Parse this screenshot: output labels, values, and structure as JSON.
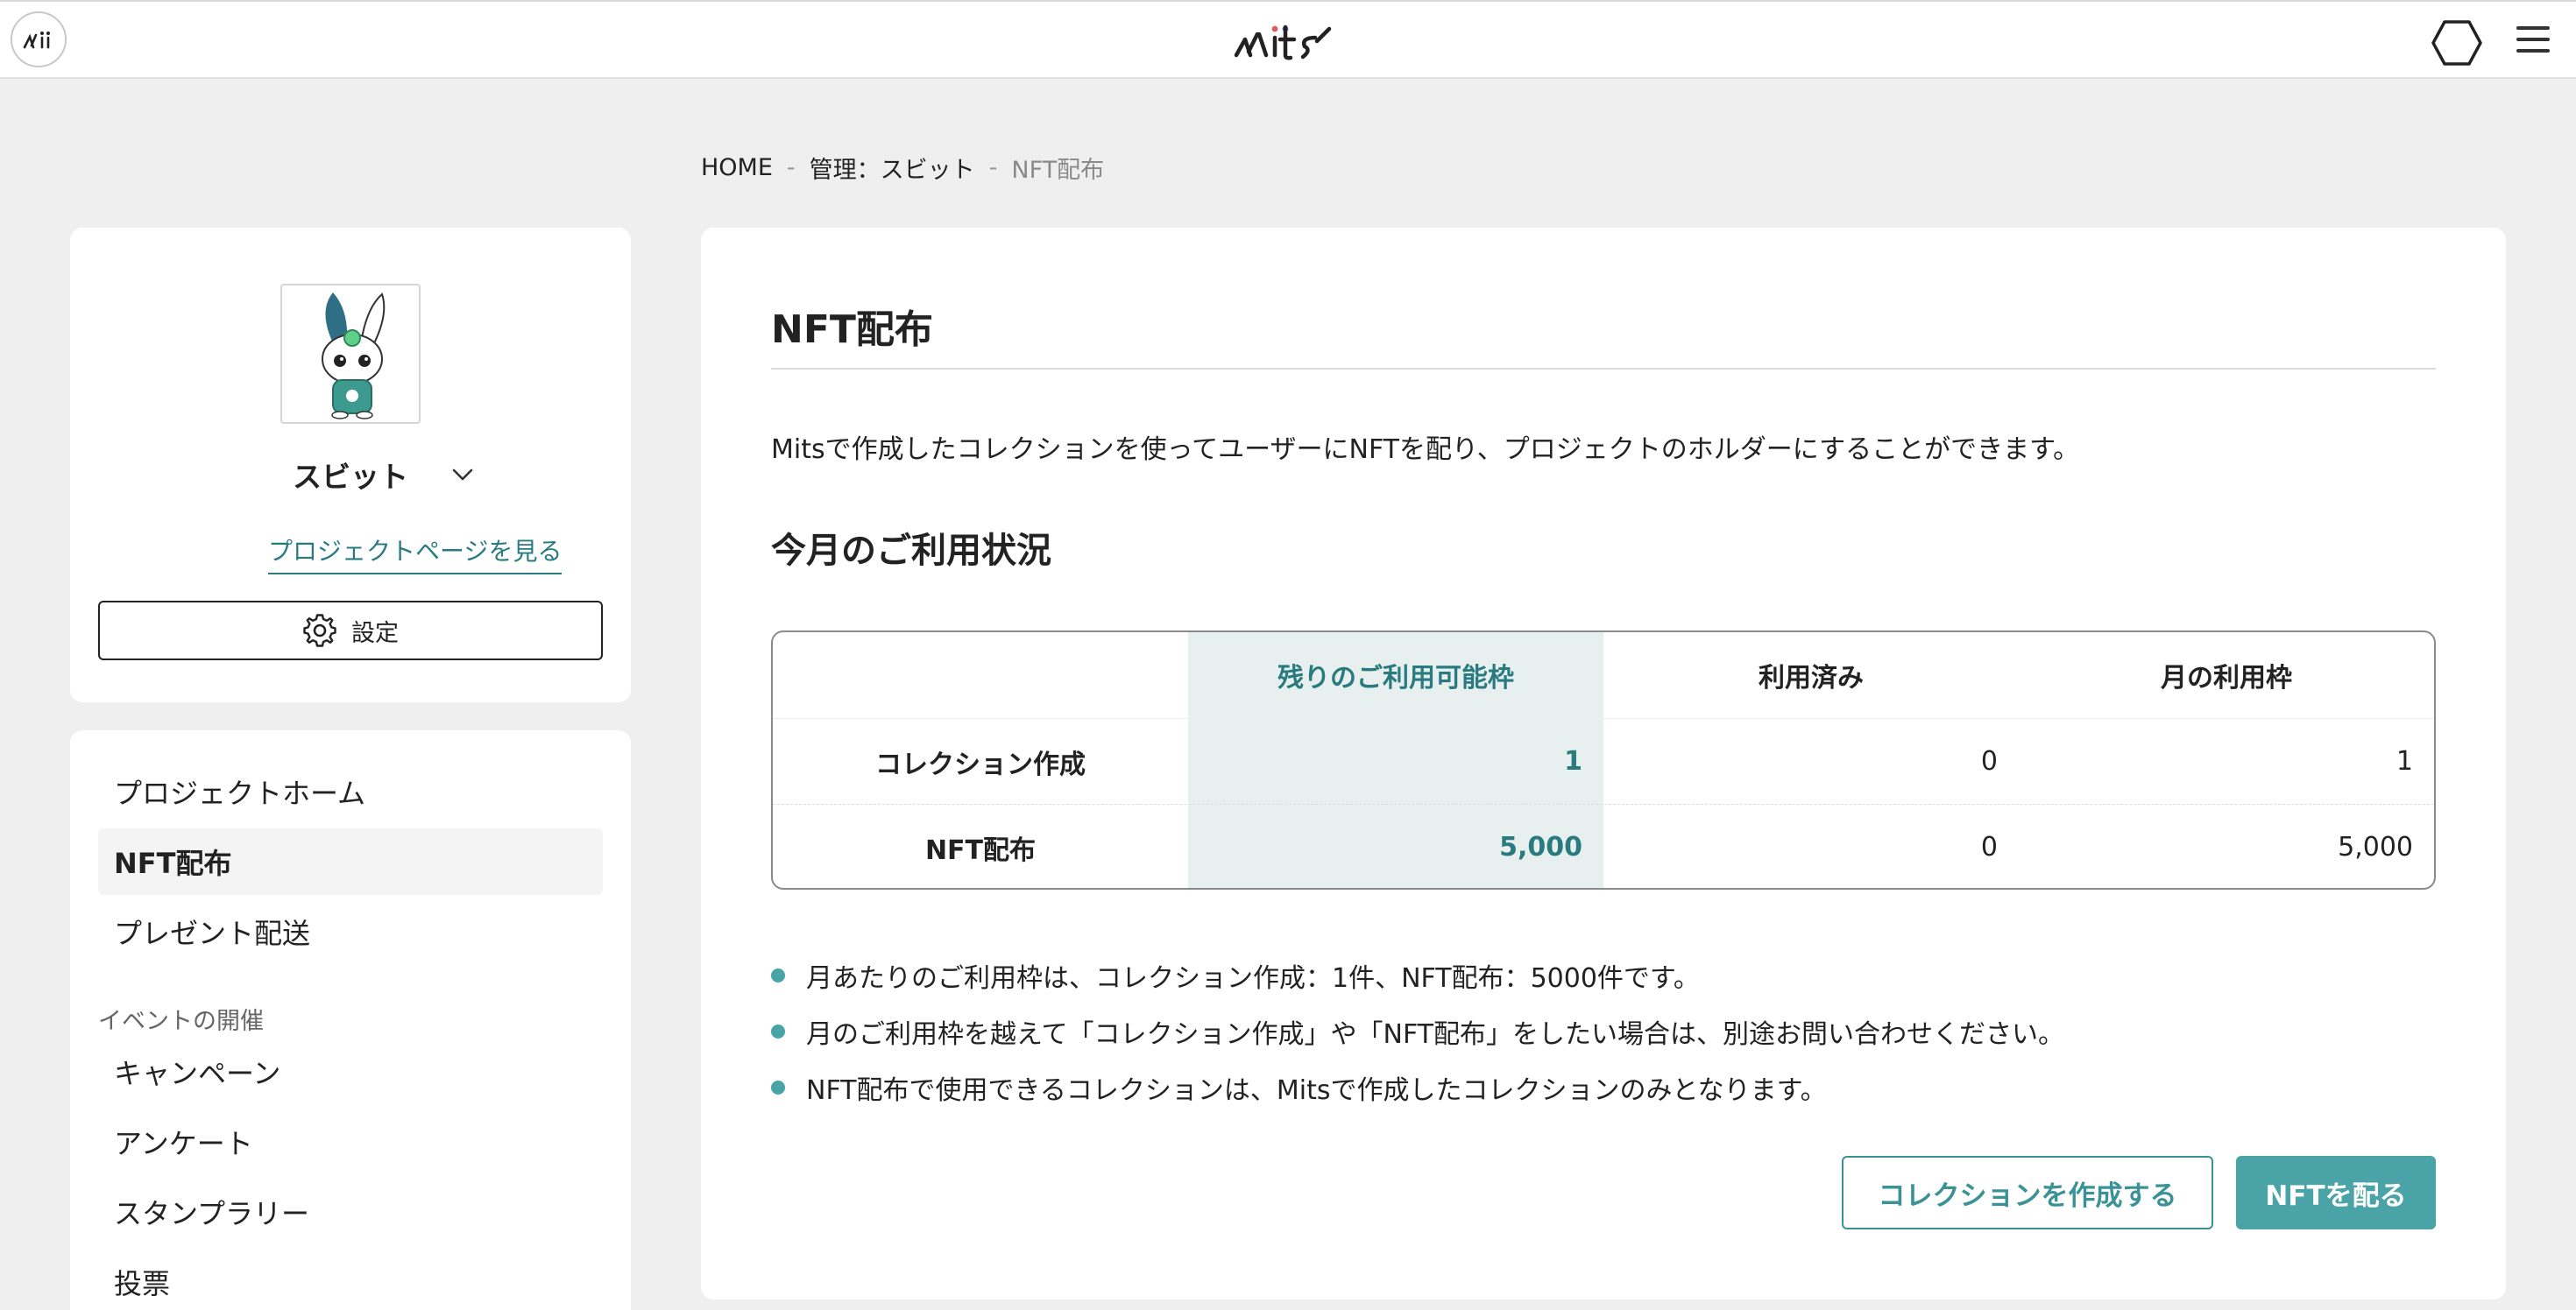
{
  "header": {
    "avatar_icon": "user-avatar-icon",
    "logo_text": "mits",
    "right_icons": [
      "hexagon-icon",
      "menu-icon"
    ]
  },
  "breadcrumb": {
    "items": [
      "HOME",
      "管理：スビット",
      "NFT配布"
    ],
    "separator": "-"
  },
  "sidebar": {
    "project_name": "スビット",
    "project_page_link": "プロジェクトページを見る",
    "settings_label": "設定",
    "nav": {
      "items": [
        {
          "label": "プロジェクトホーム",
          "active": false
        },
        {
          "label": "NFT配布",
          "active": true
        },
        {
          "label": "プレゼント配送",
          "active": false
        }
      ],
      "section_label": "イベントの開催",
      "section_items": [
        "キャンペーン",
        "アンケート",
        "スタンプラリー",
        "投票"
      ]
    }
  },
  "main": {
    "title": "NFT配布",
    "description": "Mitsで作成したコレクションを使ってユーザーにNFTを配り、プロジェクトのホルダーにすることができます。",
    "usage_heading": "今月のご利用状況",
    "table": {
      "headers": [
        "",
        "残りのご利用可能枠",
        "利用済み",
        "月の利用枠"
      ],
      "rows": [
        [
          "コレクション作成",
          "1",
          "0",
          "1"
        ],
        [
          "NFT配布",
          "5,000",
          "0",
          "5,000"
        ]
      ]
    },
    "notes": [
      "月あたりのご利用枠は、コレクション作成：1件、NFT配布：5000件です。",
      "月のご利用枠を越えて「コレクション作成」や「NFT配布」をしたい場合は、別途お問い合わせください。",
      "NFT配布で使用できるコレクションは、Mitsで作成したコレクションのみとなります。"
    ],
    "create_collection_button": "コレクションを作成する",
    "distribute_nft_button": "NFTを配る"
  },
  "colors": {
    "accent": "#4aa3a6",
    "accent_text": "#2a7b80",
    "highlight_column": "#e8f0ef",
    "background": "#efefef"
  }
}
